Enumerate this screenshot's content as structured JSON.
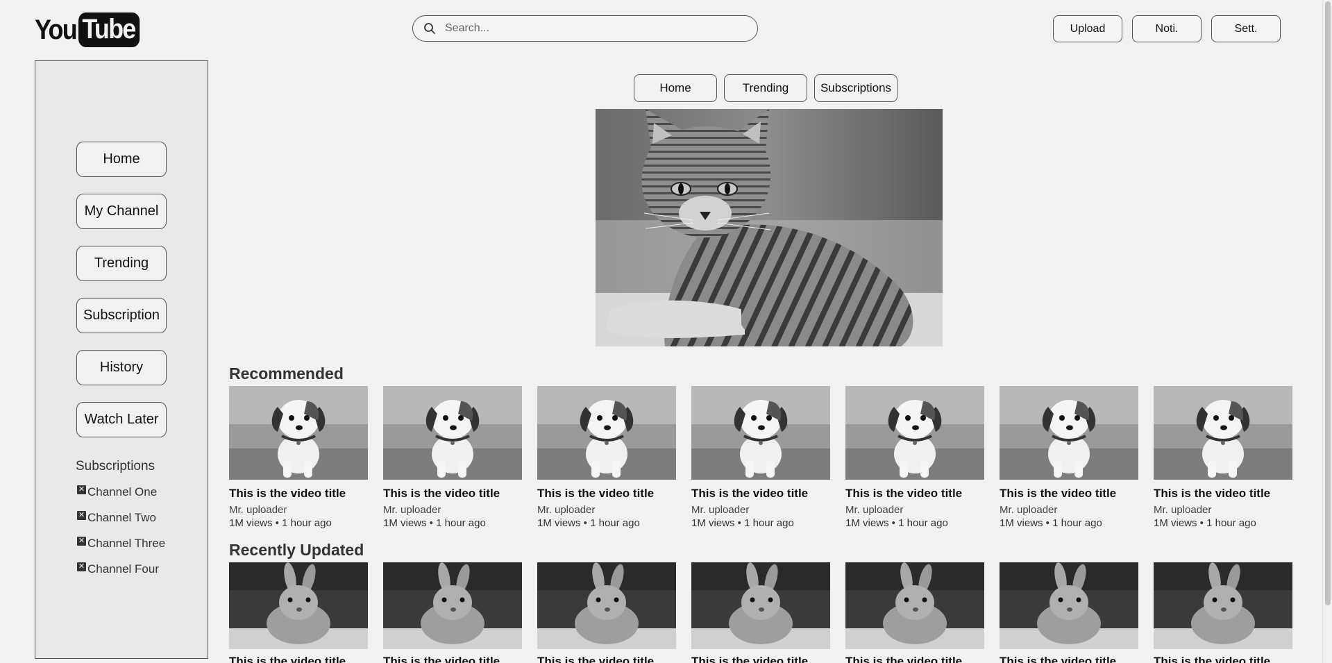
{
  "header": {
    "logo_you": "You",
    "logo_tube": "Tube",
    "search_placeholder": "Search...",
    "upload_label": "Upload",
    "notifications_label": "Noti.",
    "settings_label": "Sett."
  },
  "sidebar": {
    "items": [
      {
        "label": "Home"
      },
      {
        "label": "My Channel"
      },
      {
        "label": "Trending"
      },
      {
        "label": "Subscription"
      },
      {
        "label": "History"
      },
      {
        "label": "Watch Later"
      }
    ],
    "subscriptions_title": "Subscriptions",
    "subscriptions": [
      {
        "label": "Channel One",
        "icon": "close-box-icon"
      },
      {
        "label": "Channel Two",
        "icon": "close-box-icon"
      },
      {
        "label": "Channel Three",
        "icon": "close-box-icon"
      },
      {
        "label": "Channel Four",
        "icon": "close-box-icon"
      }
    ]
  },
  "tabs": [
    {
      "label": "Home"
    },
    {
      "label": "Trending"
    },
    {
      "label": "Subscriptions"
    }
  ],
  "hero": {
    "image": "cat-photo-grayscale"
  },
  "recommended": {
    "title": "Recommended",
    "thumbnail": "puppy-photo-grayscale",
    "videos": [
      {
        "title": "This is the video title",
        "uploader": "Mr. uploader",
        "meta": "1M views • 1 hour ago"
      },
      {
        "title": "This is the video title",
        "uploader": "Mr. uploader",
        "meta": "1M views • 1 hour ago"
      },
      {
        "title": "This is the video title",
        "uploader": "Mr. uploader",
        "meta": "1M views • 1 hour ago"
      },
      {
        "title": "This is the video title",
        "uploader": "Mr. uploader",
        "meta": "1M views • 1 hour ago"
      },
      {
        "title": "This is the video title",
        "uploader": "Mr. uploader",
        "meta": "1M views • 1 hour ago"
      },
      {
        "title": "This is the video title",
        "uploader": "Mr. uploader",
        "meta": "1M views • 1 hour ago"
      },
      {
        "title": "This is the video title",
        "uploader": "Mr. uploader",
        "meta": "1M views • 1 hour ago"
      }
    ]
  },
  "recently_updated": {
    "title": "Recently Updated",
    "thumbnail": "bunny-photo-grayscale",
    "videos": [
      {
        "title": "This is the video title"
      },
      {
        "title": "This is the video title"
      },
      {
        "title": "This is the video title"
      },
      {
        "title": "This is the video title"
      },
      {
        "title": "This is the video title"
      },
      {
        "title": "This is the video title"
      },
      {
        "title": "This is the video title"
      }
    ]
  },
  "colors": {
    "background": "#f1f1f1",
    "sidebar_bg": "#e9e9e9",
    "border": "#555555",
    "text": "#111111"
  }
}
